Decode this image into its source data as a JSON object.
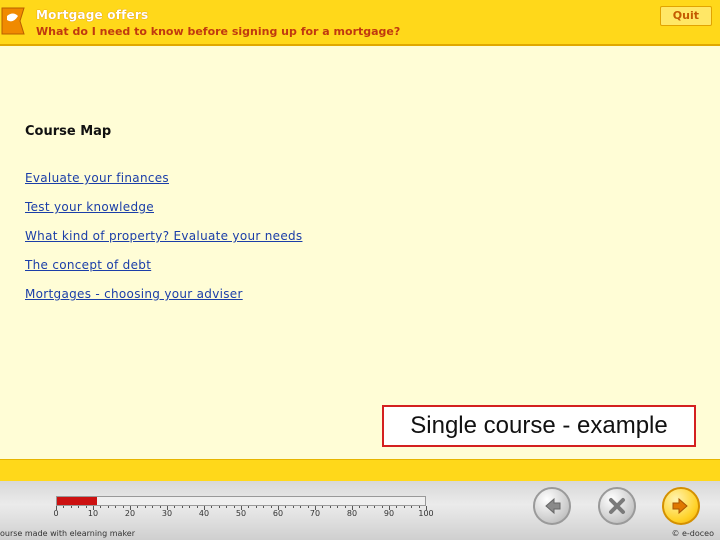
{
  "header": {
    "title": "Mortgage offers",
    "subtitle": "What do I need to know before signing up for a mortgage?",
    "quit_label": "Quit"
  },
  "main": {
    "section_title": "Course Map",
    "links": [
      {
        "label": "Evaluate your finances"
      },
      {
        "label": "Test your knowledge"
      },
      {
        "label": "What kind of property? Evaluate your needs"
      },
      {
        "label": "The concept of debt"
      },
      {
        "label": "Mortgages - choosing your adviser"
      }
    ]
  },
  "caption": "Single course - example",
  "footer": {
    "progress": {
      "value_percent": 11,
      "tick_labels": [
        "0",
        "10",
        "20",
        "30",
        "40",
        "50",
        "60",
        "70",
        "80",
        "90",
        "100"
      ],
      "fill_color": "#cc1111"
    },
    "buttons": {
      "back": "back-arrow-icon",
      "close": "close-x-icon",
      "next": "next-arrow-icon"
    },
    "credit_left": "ourse made with elearning maker",
    "credit_right": "© e-doceo"
  },
  "colors": {
    "accent": "#ffd81a",
    "background": "#fffdd6",
    "link": "#1b3ea8",
    "subtitle": "#c0390f"
  }
}
